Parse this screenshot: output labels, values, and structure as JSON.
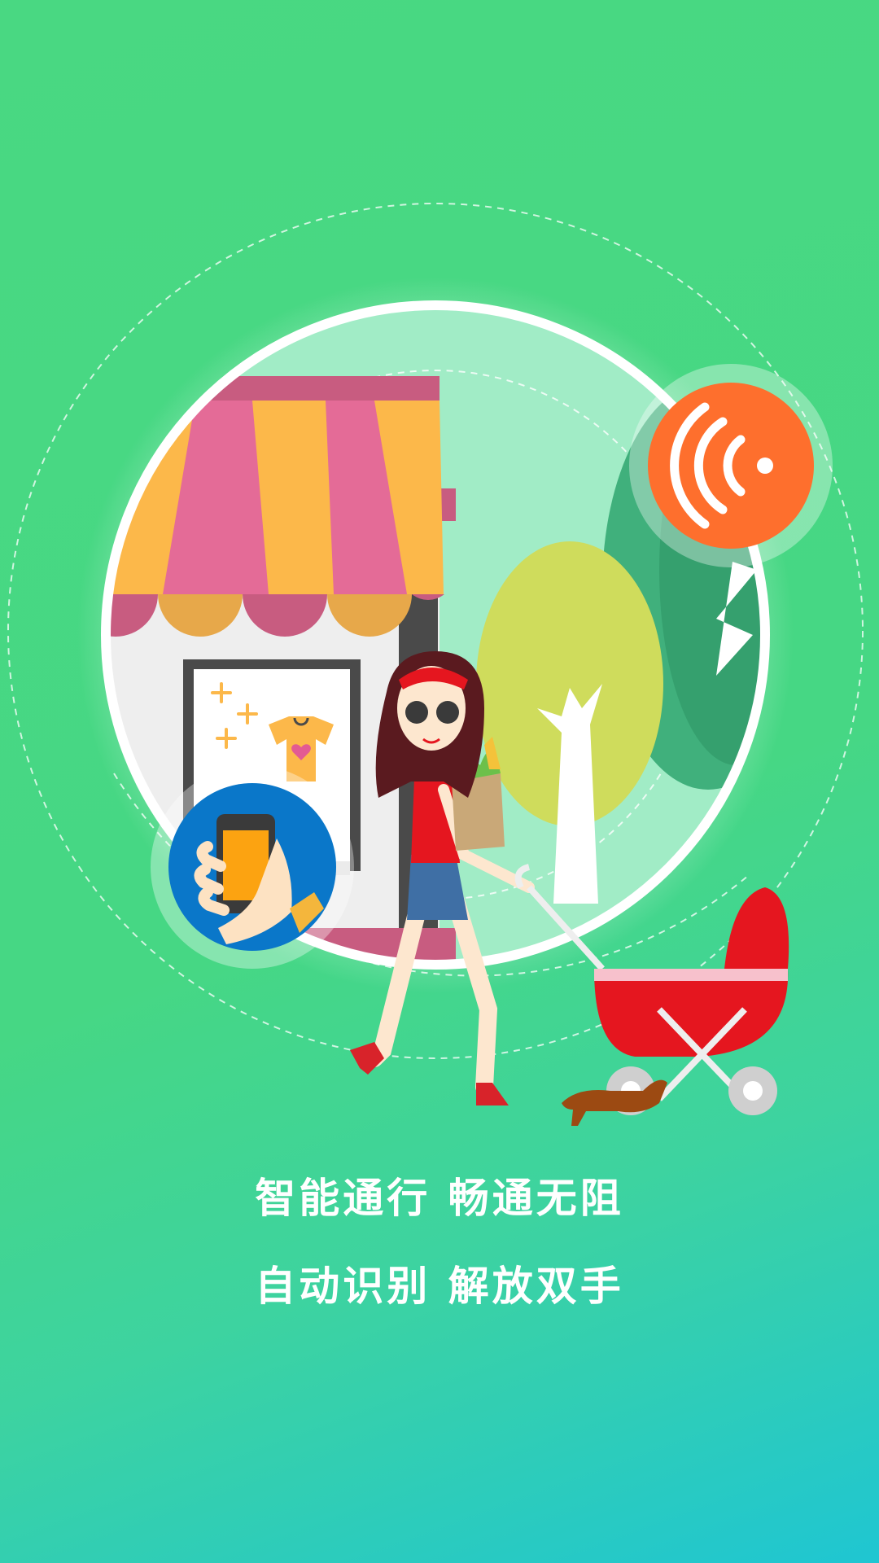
{
  "theme": {
    "bg_top": "#49d882",
    "bg_bottom": "#1fc6d2",
    "accent_orange": "#fe6f2d",
    "accent_blue": "#0a77c9"
  },
  "illustration": {
    "icons": [
      "wireless-signal-icon",
      "phone-in-hand-icon",
      "shop-awning",
      "tshirt-icon",
      "woman-with-groceries",
      "baby-stroller",
      "dog",
      "trees"
    ]
  },
  "slogan": {
    "line1": "智能通行 畅通无阻",
    "line2": "自动识别 解放双手"
  }
}
